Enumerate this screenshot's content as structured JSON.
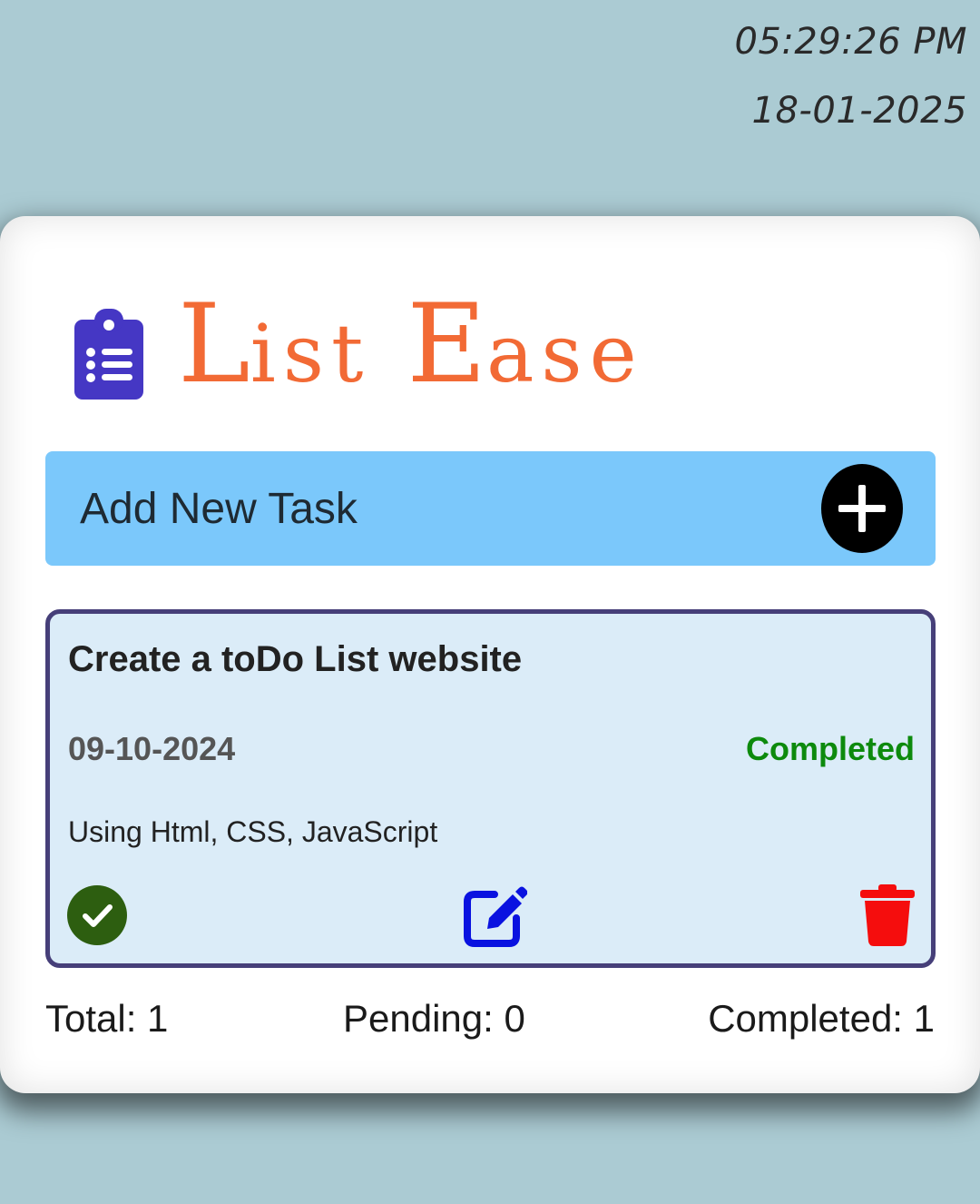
{
  "clock": {
    "time": "05:29:26 PM",
    "date": "18-01-2025"
  },
  "brand": {
    "icon": "clipboard-list-icon",
    "word1_cap": "L",
    "word1_rest": "ist",
    "word2_cap": "E",
    "word2_rest": "ase",
    "color": "#f26a35",
    "icon_color": "#4537c4"
  },
  "add_task": {
    "placeholder": "Add New Task",
    "value": "",
    "button_icon": "plus-circle-icon",
    "bar_color": "#7bc8fb"
  },
  "tasks": [
    {
      "title": "Create a toDo List website",
      "date": "09-10-2024",
      "status": "Completed",
      "description": "Using Html, CSS, JavaScript",
      "actions": [
        "check-circle-icon",
        "edit-icon",
        "trash-icon"
      ]
    }
  ],
  "stats": {
    "total": "Total: 1",
    "pending": "Pending: 0",
    "completed": "Completed: 1"
  },
  "colors": {
    "background": "#abcbd3",
    "status_completed": "#0d8a0d",
    "task_border": "#463f79",
    "task_bg": "#dbecf8",
    "check": "#2d5e10",
    "edit": "#0a12e0",
    "delete": "#f50d0d"
  }
}
